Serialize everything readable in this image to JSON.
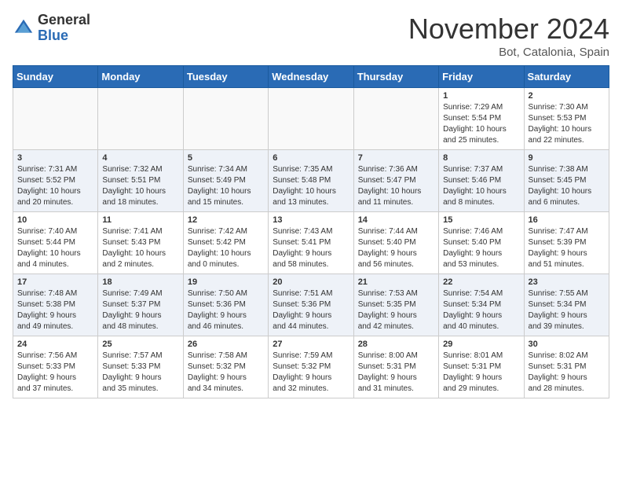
{
  "logo": {
    "general": "General",
    "blue": "Blue"
  },
  "title": "November 2024",
  "location": "Bot, Catalonia, Spain",
  "weekdays": [
    "Sunday",
    "Monday",
    "Tuesday",
    "Wednesday",
    "Thursday",
    "Friday",
    "Saturday"
  ],
  "weeks": [
    [
      {
        "day": "",
        "info": ""
      },
      {
        "day": "",
        "info": ""
      },
      {
        "day": "",
        "info": ""
      },
      {
        "day": "",
        "info": ""
      },
      {
        "day": "",
        "info": ""
      },
      {
        "day": "1",
        "info": "Sunrise: 7:29 AM\nSunset: 5:54 PM\nDaylight: 10 hours\nand 25 minutes."
      },
      {
        "day": "2",
        "info": "Sunrise: 7:30 AM\nSunset: 5:53 PM\nDaylight: 10 hours\nand 22 minutes."
      }
    ],
    [
      {
        "day": "3",
        "info": "Sunrise: 7:31 AM\nSunset: 5:52 PM\nDaylight: 10 hours\nand 20 minutes."
      },
      {
        "day": "4",
        "info": "Sunrise: 7:32 AM\nSunset: 5:51 PM\nDaylight: 10 hours\nand 18 minutes."
      },
      {
        "day": "5",
        "info": "Sunrise: 7:34 AM\nSunset: 5:49 PM\nDaylight: 10 hours\nand 15 minutes."
      },
      {
        "day": "6",
        "info": "Sunrise: 7:35 AM\nSunset: 5:48 PM\nDaylight: 10 hours\nand 13 minutes."
      },
      {
        "day": "7",
        "info": "Sunrise: 7:36 AM\nSunset: 5:47 PM\nDaylight: 10 hours\nand 11 minutes."
      },
      {
        "day": "8",
        "info": "Sunrise: 7:37 AM\nSunset: 5:46 PM\nDaylight: 10 hours\nand 8 minutes."
      },
      {
        "day": "9",
        "info": "Sunrise: 7:38 AM\nSunset: 5:45 PM\nDaylight: 10 hours\nand 6 minutes."
      }
    ],
    [
      {
        "day": "10",
        "info": "Sunrise: 7:40 AM\nSunset: 5:44 PM\nDaylight: 10 hours\nand 4 minutes."
      },
      {
        "day": "11",
        "info": "Sunrise: 7:41 AM\nSunset: 5:43 PM\nDaylight: 10 hours\nand 2 minutes."
      },
      {
        "day": "12",
        "info": "Sunrise: 7:42 AM\nSunset: 5:42 PM\nDaylight: 10 hours\nand 0 minutes."
      },
      {
        "day": "13",
        "info": "Sunrise: 7:43 AM\nSunset: 5:41 PM\nDaylight: 9 hours\nand 58 minutes."
      },
      {
        "day": "14",
        "info": "Sunrise: 7:44 AM\nSunset: 5:40 PM\nDaylight: 9 hours\nand 56 minutes."
      },
      {
        "day": "15",
        "info": "Sunrise: 7:46 AM\nSunset: 5:40 PM\nDaylight: 9 hours\nand 53 minutes."
      },
      {
        "day": "16",
        "info": "Sunrise: 7:47 AM\nSunset: 5:39 PM\nDaylight: 9 hours\nand 51 minutes."
      }
    ],
    [
      {
        "day": "17",
        "info": "Sunrise: 7:48 AM\nSunset: 5:38 PM\nDaylight: 9 hours\nand 49 minutes."
      },
      {
        "day": "18",
        "info": "Sunrise: 7:49 AM\nSunset: 5:37 PM\nDaylight: 9 hours\nand 48 minutes."
      },
      {
        "day": "19",
        "info": "Sunrise: 7:50 AM\nSunset: 5:36 PM\nDaylight: 9 hours\nand 46 minutes."
      },
      {
        "day": "20",
        "info": "Sunrise: 7:51 AM\nSunset: 5:36 PM\nDaylight: 9 hours\nand 44 minutes."
      },
      {
        "day": "21",
        "info": "Sunrise: 7:53 AM\nSunset: 5:35 PM\nDaylight: 9 hours\nand 42 minutes."
      },
      {
        "day": "22",
        "info": "Sunrise: 7:54 AM\nSunset: 5:34 PM\nDaylight: 9 hours\nand 40 minutes."
      },
      {
        "day": "23",
        "info": "Sunrise: 7:55 AM\nSunset: 5:34 PM\nDaylight: 9 hours\nand 39 minutes."
      }
    ],
    [
      {
        "day": "24",
        "info": "Sunrise: 7:56 AM\nSunset: 5:33 PM\nDaylight: 9 hours\nand 37 minutes."
      },
      {
        "day": "25",
        "info": "Sunrise: 7:57 AM\nSunset: 5:33 PM\nDaylight: 9 hours\nand 35 minutes."
      },
      {
        "day": "26",
        "info": "Sunrise: 7:58 AM\nSunset: 5:32 PM\nDaylight: 9 hours\nand 34 minutes."
      },
      {
        "day": "27",
        "info": "Sunrise: 7:59 AM\nSunset: 5:32 PM\nDaylight: 9 hours\nand 32 minutes."
      },
      {
        "day": "28",
        "info": "Sunrise: 8:00 AM\nSunset: 5:31 PM\nDaylight: 9 hours\nand 31 minutes."
      },
      {
        "day": "29",
        "info": "Sunrise: 8:01 AM\nSunset: 5:31 PM\nDaylight: 9 hours\nand 29 minutes."
      },
      {
        "day": "30",
        "info": "Sunrise: 8:02 AM\nSunset: 5:31 PM\nDaylight: 9 hours\nand 28 minutes."
      }
    ]
  ]
}
